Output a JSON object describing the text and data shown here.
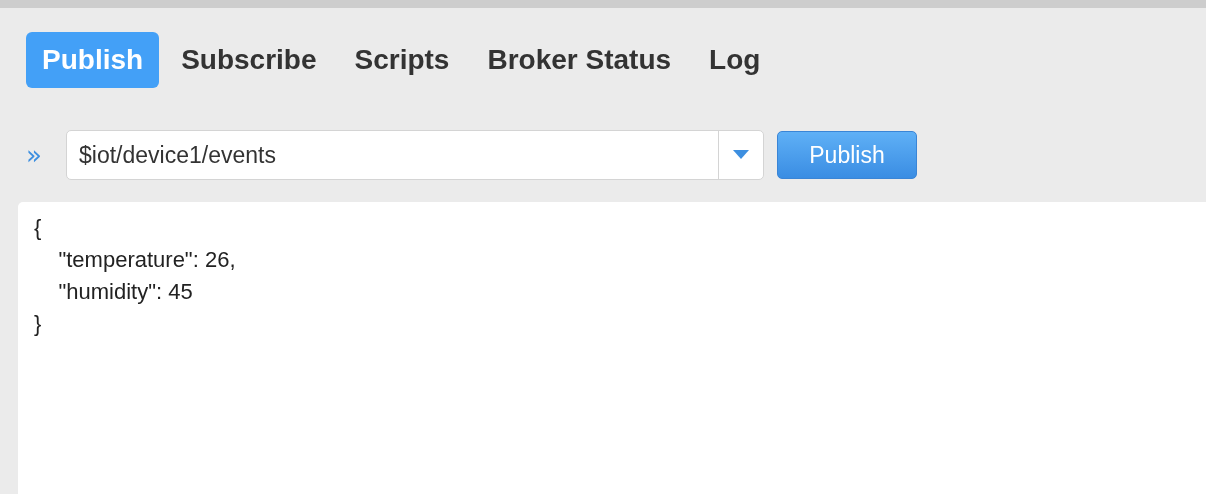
{
  "tabs": [
    {
      "label": "Publish",
      "selected": true
    },
    {
      "label": "Subscribe",
      "selected": false
    },
    {
      "label": "Scripts",
      "selected": false
    },
    {
      "label": "Broker Status",
      "selected": false
    },
    {
      "label": "Log",
      "selected": false
    }
  ],
  "publish_bar": {
    "expand_icon": "»",
    "topic": "$iot/device1/events",
    "button": "Publish"
  },
  "editor": {
    "content": "{\n    \"temperature\": 26,\n    \"humidity\": 45\n}"
  }
}
